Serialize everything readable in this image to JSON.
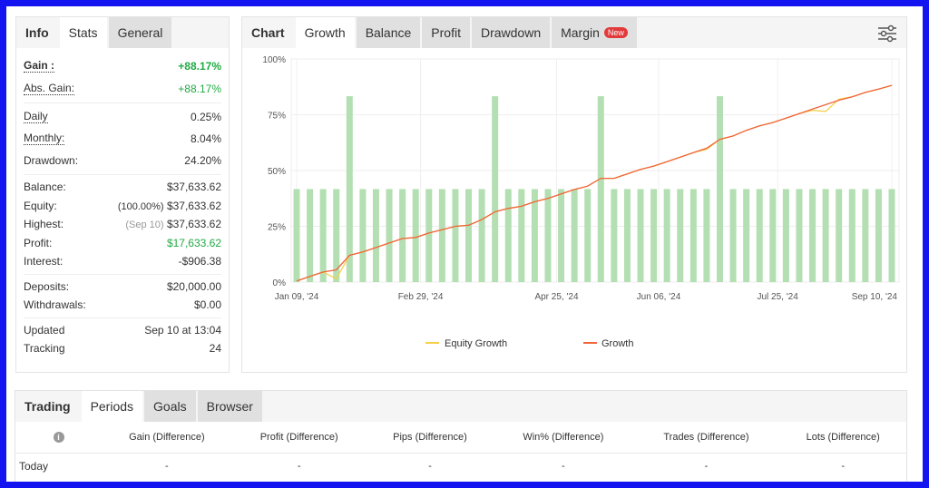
{
  "colors": {
    "gain": "#22aa44",
    "bar": "#b3dfb3",
    "growth": "#f0643c",
    "equity": "#f7cf4a",
    "border": "#1414f0"
  },
  "left": {
    "tabs": [
      "Info",
      "Stats",
      "General"
    ],
    "gain_label": "Gain :",
    "gain": "+88.17%",
    "abs_gain_label": "Abs. Gain:",
    "abs_gain": "+88.17%",
    "daily_label": "Daily",
    "daily": "0.25%",
    "monthly_label": "Monthly:",
    "monthly": "8.04%",
    "drawdown_label": "Drawdown:",
    "drawdown": "24.20%",
    "balance_label": "Balance:",
    "balance": "$37,633.62",
    "equity_label": "Equity:",
    "equity_pct": "(100.00%)",
    "equity": "$37,633.62",
    "highest_label": "Highest:",
    "highest_date": "(Sep 10)",
    "highest": "$37,633.62",
    "profit_label": "Profit:",
    "profit": "$17,633.62",
    "interest_label": "Interest:",
    "interest": "-$906.38",
    "deposits_label": "Deposits:",
    "deposits": "$20,000.00",
    "withdrawals_label": "Withdrawals:",
    "withdrawals": "$0.00",
    "updated_label": "Updated",
    "updated": "Sep 10 at 13:04",
    "tracking_label": "Tracking",
    "tracking": "24"
  },
  "chart": {
    "tabs": [
      "Chart",
      "Growth",
      "Balance",
      "Profit",
      "Drawdown",
      "Margin"
    ],
    "new_badge": "New",
    "settings_icon": "sliders-icon"
  },
  "chart_data": {
    "type": "line",
    "ylim": [
      0,
      100
    ],
    "yticks": [
      "0%",
      "25%",
      "50%",
      "75%",
      "100%"
    ],
    "xticks": [
      "Jan 09, '24",
      "Feb 29, '24",
      "Apr 25, '24",
      "Jun 06, '24",
      "Jul 25, '24",
      "Sep 10, '24"
    ],
    "legend": [
      "Equity Growth",
      "Growth"
    ],
    "legend_position": "bottom",
    "grid": true,
    "bars": [
      41.7,
      41.7,
      41.7,
      41.7,
      83.3,
      41.7,
      41.7,
      41.7,
      41.7,
      41.7,
      41.7,
      41.7,
      41.7,
      41.7,
      41.7,
      83.3,
      41.7,
      41.7,
      41.7,
      41.7,
      41.7,
      41.7,
      41.7,
      83.3,
      41.7,
      41.7,
      41.7,
      41.7,
      41.7,
      41.7,
      41.7,
      41.7,
      83.3,
      41.7,
      41.7,
      41.7,
      41.7,
      41.7,
      41.7,
      41.7,
      41.7,
      41.7,
      41.7,
      41.7,
      41.7,
      41.7
    ],
    "series": [
      {
        "name": "Growth",
        "values": [
          0.5,
          2.5,
          4.5,
          5.5,
          12,
          13.5,
          15.5,
          17.5,
          19.5,
          20,
          22,
          23.5,
          25,
          25.5,
          28,
          31.5,
          33,
          34,
          36,
          37.5,
          39.5,
          41.5,
          43,
          46.5,
          46.5,
          48.5,
          50.5,
          52,
          54,
          56,
          58,
          60,
          64,
          65.5,
          68,
          70,
          71.5,
          73.5,
          75.5,
          77.5,
          79.5,
          81.5,
          83,
          85,
          86.5,
          88.17
        ]
      },
      {
        "name": "Equity Growth",
        "values": [
          0.5,
          2.5,
          4.5,
          1.5,
          12,
          13.5,
          15.5,
          17.5,
          19.5,
          20,
          22,
          23.5,
          25,
          25.5,
          28,
          31.5,
          33,
          34,
          36,
          37.5,
          39.5,
          41.5,
          43,
          46.5,
          46.5,
          48.5,
          50.5,
          52,
          54,
          56,
          58,
          59.5,
          64,
          65.5,
          68,
          70,
          71.5,
          73.5,
          75.5,
          77,
          76.5,
          82,
          83,
          85,
          86.5,
          88.17
        ]
      }
    ]
  },
  "bottom": {
    "tabs": [
      "Trading",
      "Periods",
      "Goals",
      "Browser"
    ],
    "columns": [
      "Gain (Difference)",
      "Profit (Difference)",
      "Pips (Difference)",
      "Win% (Difference)",
      "Trades (Difference)",
      "Lots (Difference)"
    ],
    "rows": [
      {
        "label": "Today",
        "cells": [
          "-",
          "-",
          "-",
          "-",
          "-",
          "-"
        ]
      }
    ]
  }
}
